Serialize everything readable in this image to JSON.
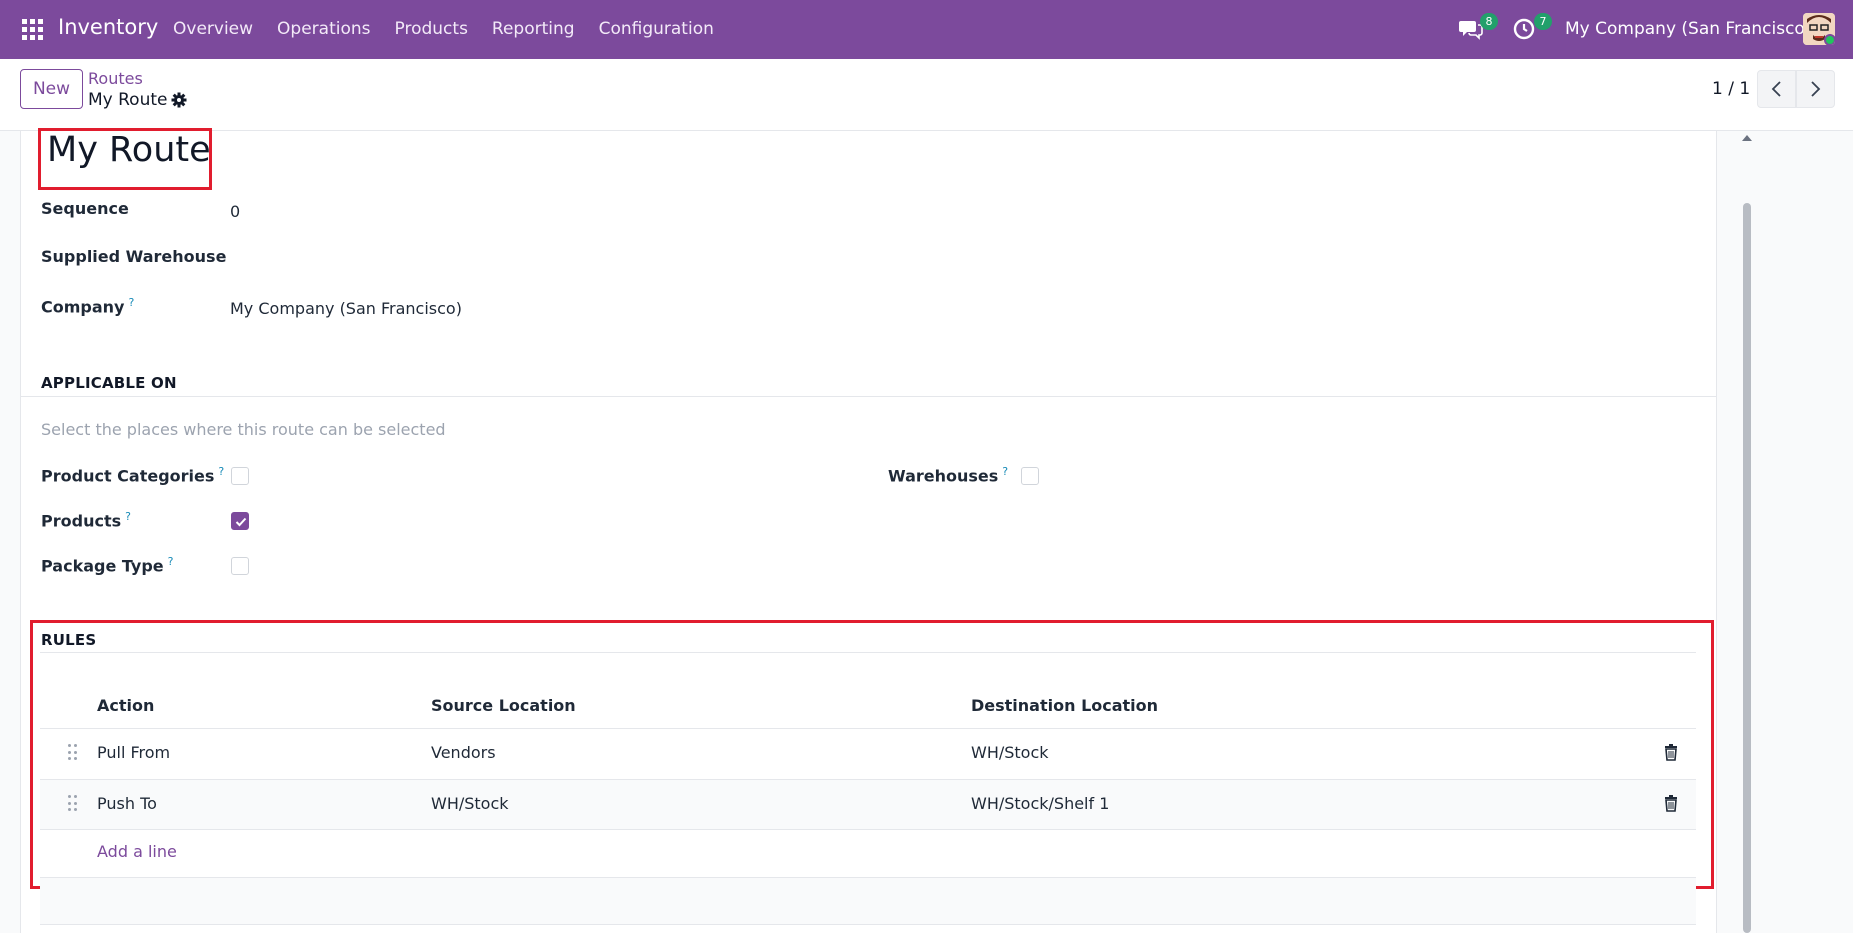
{
  "nav": {
    "app_name": "Inventory",
    "menu": [
      "Overview",
      "Operations",
      "Products",
      "Reporting",
      "Configuration"
    ],
    "messages_count": "8",
    "activities_count": "7",
    "company": "My Company (San Francisco)"
  },
  "control": {
    "new_label": "New",
    "breadcrumb_parent": "Routes",
    "breadcrumb_current": "My Route",
    "pager": "1 / 1"
  },
  "form": {
    "title": "My Route",
    "sequence_label": "Sequence",
    "sequence_value": "0",
    "supplied_warehouse_label": "Supplied Warehouse",
    "company_label": "Company",
    "company_value": "My Company (San Francisco)",
    "help_mark": "?"
  },
  "applicable": {
    "section_title": "APPLICABLE ON",
    "hint": "Select the places where this route can be selected",
    "product_categories_label": "Product Categories",
    "product_categories_checked": false,
    "products_label": "Products",
    "products_checked": true,
    "package_type_label": "Package Type",
    "package_type_checked": false,
    "warehouses_label": "Warehouses",
    "warehouses_checked": false
  },
  "rules": {
    "section_title": "RULES",
    "columns": [
      "Action",
      "Source Location",
      "Destination Location"
    ],
    "rows": [
      {
        "action": "Pull From",
        "source": "Vendors",
        "destination": "WH/Stock"
      },
      {
        "action": "Push To",
        "source": "WH/Stock",
        "destination": "WH/Stock/Shelf 1"
      }
    ],
    "add_line": "Add a line"
  },
  "colors": {
    "brand": "#7c4a9c",
    "highlight": "#e11d2e",
    "badge": "#22a06b"
  }
}
